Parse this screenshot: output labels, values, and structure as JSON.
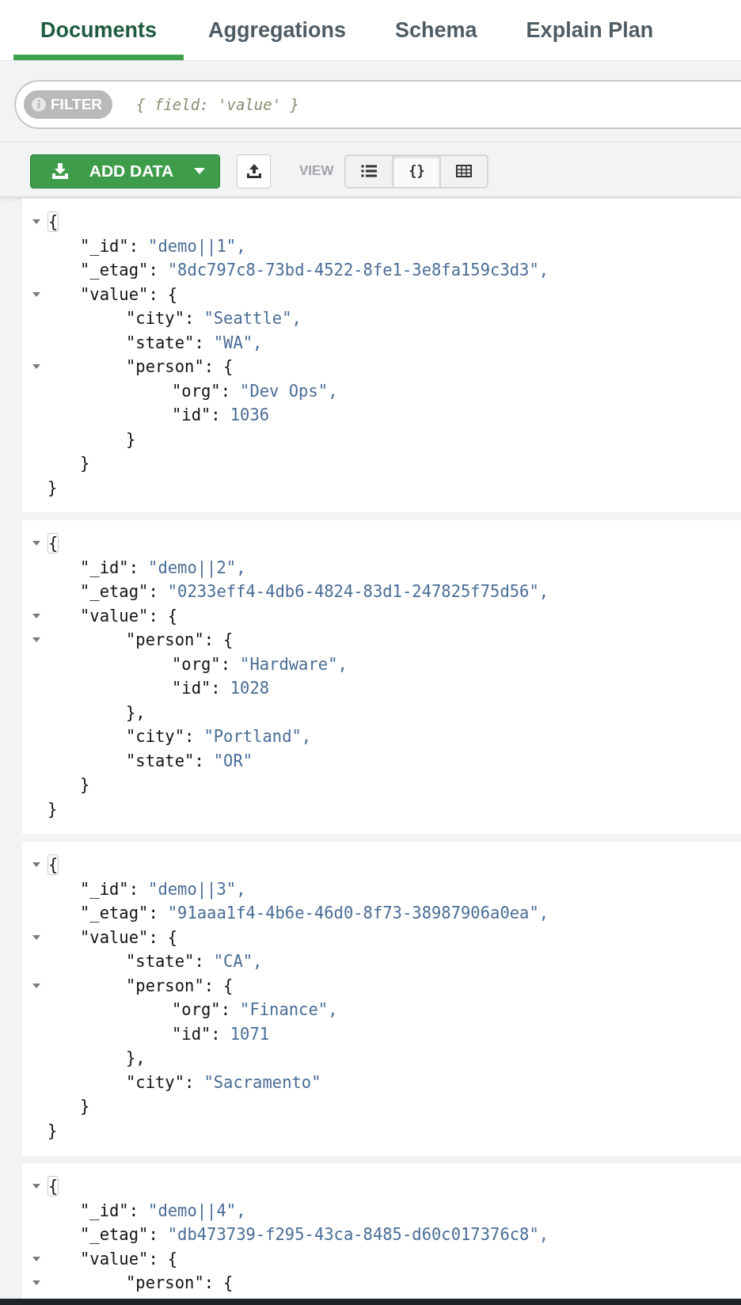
{
  "tabs": [
    {
      "label": "Documents",
      "selected": true
    },
    {
      "label": "Aggregations",
      "selected": false
    },
    {
      "label": "Schema",
      "selected": false
    },
    {
      "label": "Explain Plan",
      "selected": false
    }
  ],
  "filter": {
    "badge": "FILTER",
    "placeholder": "{ field: 'value' }"
  },
  "toolbar": {
    "add_data": "ADD DATA",
    "view_label": "VIEW",
    "views": [
      {
        "kind": "list",
        "selected": false
      },
      {
        "kind": "json",
        "label": "{}",
        "selected": true
      },
      {
        "kind": "table",
        "selected": false
      }
    ]
  },
  "documents": [
    {
      "expanded": true,
      "open": "{",
      "close": "}",
      "fields": [
        {
          "key": "\"_id\":",
          "value": "\"demo||1\","
        },
        {
          "key": "\"_etag\":",
          "value": "\"8dc797c8-73bd-4522-8fe1-3e8fa159c3d3\","
        },
        {
          "key": "\"value\":",
          "open": "{",
          "close": "}",
          "expanded": true,
          "children": [
            {
              "key": "\"city\":",
              "value": "\"Seattle\","
            },
            {
              "key": "\"state\":",
              "value": "\"WA\","
            },
            {
              "key": "\"person\":",
              "open": "{",
              "close": "}",
              "expanded": true,
              "children": [
                {
                  "key": "\"org\":",
                  "value": "\"Dev Ops\","
                },
                {
                  "key": "\"id\":",
                  "value": "1036"
                }
              ]
            }
          ]
        }
      ]
    },
    {
      "expanded": true,
      "open": "{",
      "close": "}",
      "fields": [
        {
          "key": "\"_id\":",
          "value": "\"demo||2\","
        },
        {
          "key": "\"_etag\":",
          "value": "\"0233eff4-4db6-4824-83d1-247825f75d56\","
        },
        {
          "key": "\"value\":",
          "open": "{",
          "close": "}",
          "expanded": true,
          "children": [
            {
              "key": "\"person\":",
              "open": "{",
              "close": "},",
              "expanded": true,
              "children": [
                {
                  "key": "\"org\":",
                  "value": "\"Hardware\","
                },
                {
                  "key": "\"id\":",
                  "value": "1028"
                }
              ]
            },
            {
              "key": "\"city\":",
              "value": "\"Portland\","
            },
            {
              "key": "\"state\":",
              "value": "\"OR\""
            }
          ]
        }
      ]
    },
    {
      "expanded": true,
      "open": "{",
      "close": "}",
      "fields": [
        {
          "key": "\"_id\":",
          "value": "\"demo||3\","
        },
        {
          "key": "\"_etag\":",
          "value": "\"91aaa1f4-4b6e-46d0-8f73-38987906a0ea\","
        },
        {
          "key": "\"value\":",
          "open": "{",
          "close": "}",
          "expanded": true,
          "children": [
            {
              "key": "\"state\":",
              "value": "\"CA\","
            },
            {
              "key": "\"person\":",
              "open": "{",
              "close": "},",
              "expanded": true,
              "children": [
                {
                  "key": "\"org\":",
                  "value": "\"Finance\","
                },
                {
                  "key": "\"id\":",
                  "value": "1071"
                }
              ]
            },
            {
              "key": "\"city\":",
              "value": "\"Sacramento\""
            }
          ]
        }
      ]
    },
    {
      "expanded": true,
      "open": "{",
      "fields": [
        {
          "key": "\"_id\":",
          "value": "\"demo||4\","
        },
        {
          "key": "\"_etag\":",
          "value": "\"db473739-f295-43ca-8485-d60c017376c8\","
        },
        {
          "key": "\"value\":",
          "open": "{",
          "expanded": true,
          "children": [
            {
              "key": "\"person\":",
              "open": "{",
              "expanded": true
            }
          ]
        }
      ]
    }
  ]
}
